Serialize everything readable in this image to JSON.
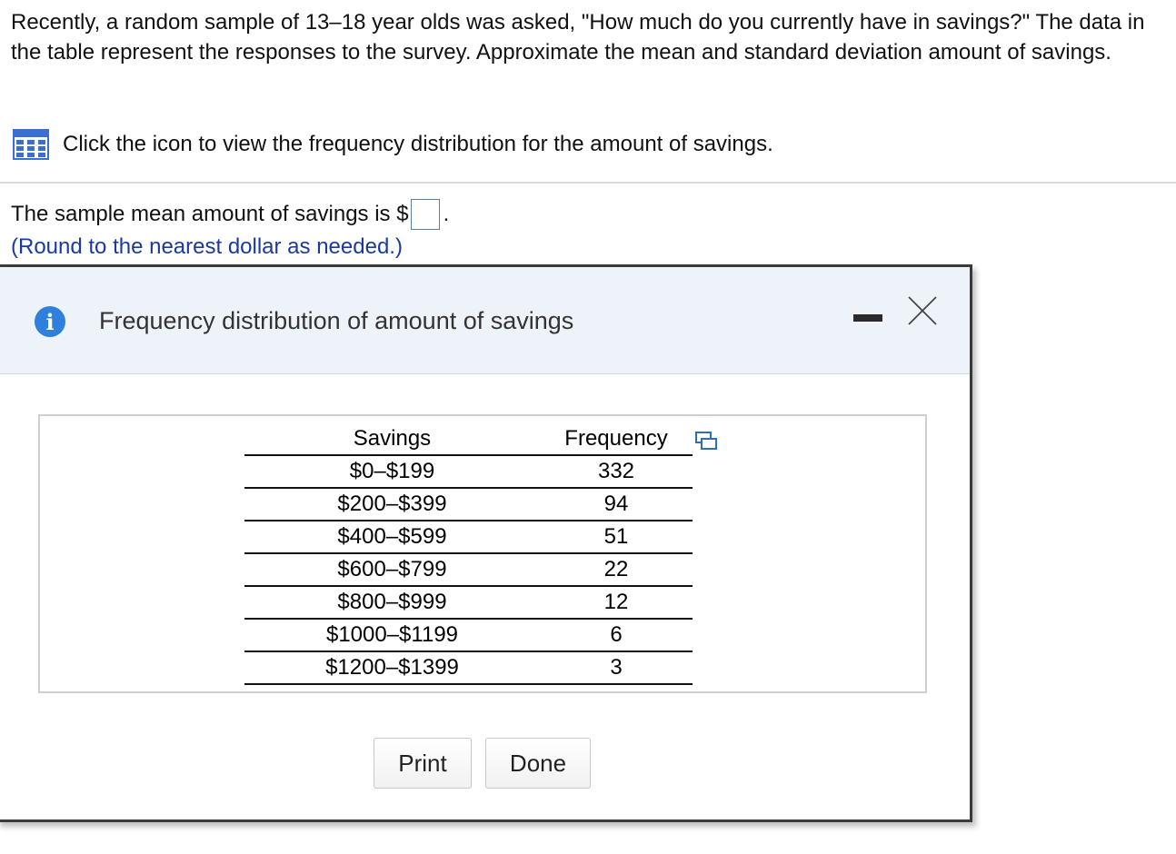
{
  "question": {
    "text": "Recently, a random sample of 13–18 year olds was asked, \"How much do you currently have in savings?\" The data in the table represent the responses to the survey. Approximate the mean and standard deviation amount of savings.",
    "icon_prompt": "Click the icon to view the frequency distribution for the amount of savings.",
    "icon": "table-grid-icon"
  },
  "answer": {
    "prefix": "The sample mean amount of savings is $",
    "value": "",
    "suffix": ".",
    "hint": "(Round to the nearest dollar as needed.)"
  },
  "dialog": {
    "title": "Frequency distribution of amount of savings",
    "info_icon": "info-icon",
    "minimize_icon": "minimize-icon",
    "close_icon": "close-icon",
    "copy_icon": "copy-icon",
    "table": {
      "headers": [
        "Savings",
        "Frequency"
      ],
      "rows": [
        {
          "savings": "$0–$199",
          "frequency": "332"
        },
        {
          "savings": "$200–$399",
          "frequency": "94"
        },
        {
          "savings": "$400–$599",
          "frequency": "51"
        },
        {
          "savings": "$600–$799",
          "frequency": "22"
        },
        {
          "savings": "$800–$999",
          "frequency": "12"
        },
        {
          "savings": "$1000–$1199",
          "frequency": "6"
        },
        {
          "savings": "$1200–$1399",
          "frequency": "3"
        }
      ]
    },
    "buttons": {
      "print": "Print",
      "done": "Done"
    }
  },
  "colors": {
    "hint": "#1a3aa1",
    "header_bg": "#eef3fa",
    "info_blue": "#2f7fdc",
    "grid_icon_blue": "#3a6fd0"
  }
}
